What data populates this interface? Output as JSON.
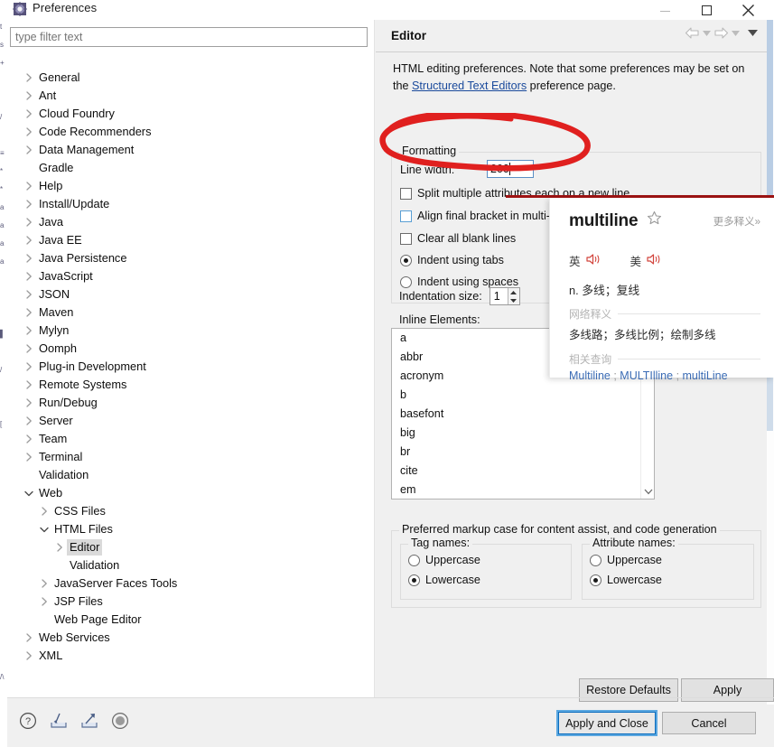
{
  "window": {
    "title": "Preferences",
    "icon": "preferences-gear-icon",
    "controls": {
      "minimize": "minimize",
      "maximize": "maximize",
      "close": "close"
    }
  },
  "sidebar": {
    "filter": {
      "value": "",
      "placeholder": "type filter text"
    },
    "items": [
      {
        "label": "General",
        "indent": 0,
        "arrow": "right"
      },
      {
        "label": "Ant",
        "indent": 0,
        "arrow": "right"
      },
      {
        "label": "Cloud Foundry",
        "indent": 0,
        "arrow": "right"
      },
      {
        "label": "Code Recommenders",
        "indent": 0,
        "arrow": "right"
      },
      {
        "label": "Data Management",
        "indent": 0,
        "arrow": "right"
      },
      {
        "label": "Gradle",
        "indent": 0,
        "arrow": "none"
      },
      {
        "label": "Help",
        "indent": 0,
        "arrow": "right"
      },
      {
        "label": "Install/Update",
        "indent": 0,
        "arrow": "right"
      },
      {
        "label": "Java",
        "indent": 0,
        "arrow": "right"
      },
      {
        "label": "Java EE",
        "indent": 0,
        "arrow": "right"
      },
      {
        "label": "Java Persistence",
        "indent": 0,
        "arrow": "right"
      },
      {
        "label": "JavaScript",
        "indent": 0,
        "arrow": "right"
      },
      {
        "label": "JSON",
        "indent": 0,
        "arrow": "right"
      },
      {
        "label": "Maven",
        "indent": 0,
        "arrow": "right"
      },
      {
        "label": "Mylyn",
        "indent": 0,
        "arrow": "right"
      },
      {
        "label": "Oomph",
        "indent": 0,
        "arrow": "right"
      },
      {
        "label": "Plug-in Development",
        "indent": 0,
        "arrow": "right"
      },
      {
        "label": "Remote Systems",
        "indent": 0,
        "arrow": "right"
      },
      {
        "label": "Run/Debug",
        "indent": 0,
        "arrow": "right"
      },
      {
        "label": "Server",
        "indent": 0,
        "arrow": "right"
      },
      {
        "label": "Team",
        "indent": 0,
        "arrow": "right"
      },
      {
        "label": "Terminal",
        "indent": 0,
        "arrow": "right"
      },
      {
        "label": "Validation",
        "indent": 0,
        "arrow": "none"
      },
      {
        "label": "Web",
        "indent": 0,
        "arrow": "down"
      },
      {
        "label": "CSS Files",
        "indent": 1,
        "arrow": "right"
      },
      {
        "label": "HTML Files",
        "indent": 1,
        "arrow": "down"
      },
      {
        "label": "Editor",
        "indent": 2,
        "arrow": "right",
        "selected": true
      },
      {
        "label": "Validation",
        "indent": 2,
        "arrow": "none"
      },
      {
        "label": "JavaServer Faces Tools",
        "indent": 1,
        "arrow": "right"
      },
      {
        "label": "JSP Files",
        "indent": 1,
        "arrow": "right"
      },
      {
        "label": "Web Page Editor",
        "indent": 1,
        "arrow": "none"
      },
      {
        "label": "Web Services",
        "indent": 0,
        "arrow": "right"
      },
      {
        "label": "XML",
        "indent": 0,
        "arrow": "right"
      }
    ]
  },
  "page": {
    "title": "Editor",
    "nav": {
      "back": "back-arrow-icon",
      "back_menu": "back-dropdown-icon",
      "forward": "forward-arrow-icon",
      "forward_menu": "forward-dropdown-icon",
      "menu": "view-menu-icon"
    },
    "description_before": "HTML editing preferences.  Note that some preferences may be set on the ",
    "description_link": "Structured Text Editors",
    "description_after": " preference page.",
    "formatting": {
      "legend": "Formatting",
      "line_width_label": "Line width:",
      "line_width_value": "200",
      "checkboxes": [
        {
          "label": "Split multiple attributes each on a new line",
          "checked": false
        },
        {
          "label": "Align final bracket in multi-line element tags",
          "checked": false,
          "hover": true
        },
        {
          "label": "Clear all blank lines",
          "checked": false
        }
      ],
      "radios": [
        {
          "label": "Indent using tabs",
          "checked": true
        },
        {
          "label": "Indent using spaces",
          "checked": false
        }
      ],
      "indentation_label": "Indentation size:",
      "indentation_value": "1"
    },
    "inline_elements": {
      "label": "Inline Elements:",
      "items": [
        "a",
        "abbr",
        "acronym",
        "b",
        "basefont",
        "big",
        "br",
        "cite",
        "em"
      ],
      "scroll_down_icon": "chevron-down-icon"
    },
    "markup_case": {
      "legend": "Preferred markup case for content assist, and code generation",
      "tag_names": {
        "legend": "Tag names:",
        "options": [
          {
            "label": "Uppercase",
            "checked": false
          },
          {
            "label": "Lowercase",
            "checked": true
          }
        ]
      },
      "attribute_names": {
        "legend": "Attribute names:",
        "options": [
          {
            "label": "Uppercase",
            "checked": false
          },
          {
            "label": "Lowercase",
            "checked": true
          }
        ]
      }
    },
    "buttons": {
      "restore_defaults": "Restore Defaults",
      "apply": "Apply"
    }
  },
  "footer": {
    "icons": [
      "help-icon",
      "import-icon",
      "export-icon",
      "record-icon"
    ],
    "apply_and_close": "Apply and Close",
    "cancel": "Cancel"
  },
  "dictionary_popup": {
    "word": "multiline",
    "star_icon": "star-outline-icon",
    "more_label": "更多释义»",
    "uk_label": "英",
    "uk_speaker_icon": "speaker-icon",
    "us_label": "美",
    "us_speaker_icon": "speaker-icon",
    "definition": "n. 多线；复线",
    "web_section_title": "网络释义",
    "web_definition": "多线路；多线比例；绘制多线",
    "related_section_title": "相关查询",
    "related_terms": [
      "Multiline",
      "MULTIlline",
      "multiLine"
    ],
    "separator": ";"
  },
  "annotation": {
    "shape": "red-hand-drawn-ellipse",
    "color": "#e0201f",
    "underline_color": "#9e1313"
  },
  "colors": {
    "dialog_bg": "#f0f0f0",
    "panel_bg": "#ffffff",
    "link": "#1a4a9c",
    "selection": "#dadada",
    "focus_border": "#0a6cbd",
    "annotation_red": "#e0201f",
    "dict_link": "#3b6cb5"
  }
}
